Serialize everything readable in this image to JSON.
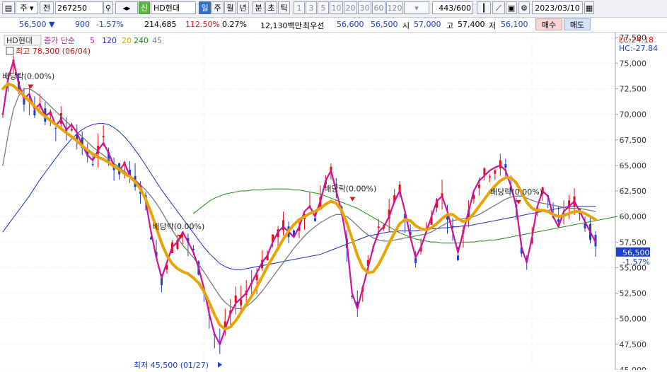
{
  "toolbar": {
    "period": "주",
    "code_prefix": "전",
    "stock_code": "267250",
    "stock_name_badge": "신",
    "stock_name": "HD현대",
    "timeframes": [
      "일",
      "주",
      "월",
      "년",
      "분",
      "초",
      "틱"
    ],
    "active_timeframe": "일",
    "periods": [
      "1",
      "3",
      "5",
      "10",
      "20",
      "30",
      "60",
      "120"
    ],
    "count": "443",
    "count_total": "/600",
    "date": "2023/03/10"
  },
  "quote": {
    "price": "56,500",
    "change": "900",
    "change_pct": "-1.57%",
    "volume": "214,685",
    "volume_ratio": "112.50%",
    "turnover": "0.27%",
    "amount": "12,130백만",
    "best_ask_label": "최우선",
    "best_ask": "56,600",
    "best_bid": "56,500",
    "open_label": "시",
    "open": "57,000",
    "high_label": "고",
    "high": "57,400",
    "low_label": "저",
    "low": "56,100",
    "buy_label": "매수",
    "sell_label": "매도"
  },
  "legend": {
    "title": "HD현대",
    "label": "종가 단순",
    "periods": [
      "5",
      "120",
      "20",
      "240",
      "45"
    ],
    "colors": [
      "#d0109a",
      "#1a2ecc",
      "#e2a400",
      "#1b8a1b",
      "#808080"
    ],
    "high_info": "최고 78,300 (06/04)"
  },
  "right_labels": {
    "lc": "LC:24.18",
    "hc": "HC:-27.84",
    "current_price": "56,500",
    "current_pct": "-1.57%"
  },
  "colors": {
    "up": "#e01010",
    "down": "#1a3fd0",
    "ma5": "#d0109a",
    "ma20": "#e8a400",
    "ma45": "#7a7a7a",
    "ma120": "#1a2ecc",
    "ma240": "#1b8a1b"
  },
  "chart_data": {
    "type": "line",
    "title": "HD현대",
    "ylim": [
      45000,
      78000
    ],
    "y_ticks": [
      "77,500",
      "75,000",
      "72,500",
      "70,000",
      "67,500",
      "65,000",
      "62,500",
      "60,000",
      "57,500",
      "55,000",
      "52,500",
      "50,000",
      "47,500",
      "45,000"
    ],
    "y_tick_values": [
      77500,
      75000,
      72500,
      70000,
      67500,
      65000,
      62500,
      60000,
      57500,
      55000,
      52500,
      50000,
      47500,
      45000
    ],
    "series": [
      {
        "name": "5",
        "values": [
          70000,
          73500,
          75200,
          73000,
          71500,
          72000,
          70500,
          71000,
          69800,
          70200,
          68900,
          69500,
          68500,
          69000,
          68200,
          67000,
          66000,
          65500,
          66500,
          67200,
          66200,
          65000,
          64500,
          65200,
          64000,
          63500,
          63000,
          61500,
          58500,
          56000,
          54000,
          55500,
          57000,
          57500,
          58500,
          57500,
          56500,
          55000,
          53000,
          50500,
          48500,
          47500,
          49000,
          50500,
          51500,
          52000,
          52500,
          53500,
          54500,
          55500,
          56200,
          57500,
          58500,
          59000,
          58500,
          58000,
          59000,
          60500,
          61000,
          60000,
          61500,
          63500,
          64500,
          62500,
          60500,
          57500,
          52500,
          51000,
          53000,
          55000,
          57000,
          58500,
          59000,
          60000,
          61500,
          62500,
          60500,
          58000,
          56000,
          57000,
          58500,
          60000,
          61500,
          62000,
          60500,
          58500,
          56500,
          58500,
          60500,
          62500,
          63500,
          64000,
          64500,
          64800,
          65000,
          64500,
          63000,
          61000,
          57000,
          55500,
          58000,
          61000,
          62500,
          62000,
          60000,
          59000,
          60500,
          61000,
          61500,
          60500,
          59500,
          58500,
          57500
        ]
      },
      {
        "name": "20",
        "values": [
          72500,
          73000,
          72800,
          72300,
          71800,
          71300,
          70800,
          70200,
          69800,
          69400,
          69000,
          68600,
          68200,
          67800,
          67400,
          66900,
          66500,
          66100,
          65800,
          65600,
          65300,
          64900,
          64600,
          64200,
          63900,
          63400,
          62700,
          61700,
          60400,
          58900,
          57400,
          56200,
          55400,
          54900,
          54600,
          54400,
          54000,
          53500,
          52700,
          51600,
          50400,
          49400,
          49000,
          49200,
          49800,
          50600,
          51400,
          52200,
          53100,
          54100,
          55100,
          56000,
          56900,
          57800,
          58600,
          59200,
          59700,
          60000,
          60300,
          60500,
          60800,
          61200,
          61500,
          61300,
          60600,
          59400,
          57800,
          56200,
          55000,
          54500,
          54600,
          55300,
          56300,
          57400,
          58400,
          59300,
          59700,
          59600,
          59100,
          58800,
          58700,
          58900,
          59300,
          59800,
          60200,
          60200,
          59800,
          59500,
          59700,
          60300,
          61000,
          61700,
          62400,
          63000,
          63500,
          63800,
          63800,
          63300,
          62400,
          61400,
          60800,
          60600,
          60600,
          60500,
          60200,
          60000,
          60100,
          60300,
          60500,
          60500,
          60300,
          60000,
          59700
        ]
      },
      {
        "name": "45",
        "values": [
          65000,
          68000,
          70500,
          71800,
          72500,
          72500,
          72200,
          71800,
          71300,
          70800,
          70300,
          69800,
          69300,
          68800,
          68300,
          67800,
          67300,
          66800,
          66400,
          66000,
          65600,
          65200,
          64800,
          64400,
          64000,
          63600,
          63100,
          62600,
          62000,
          61300,
          60500,
          59600,
          58700,
          57900,
          57200,
          56600,
          56000,
          55300,
          54600,
          53800,
          53000,
          52200,
          51600,
          51200,
          51000,
          51000,
          51200,
          51600,
          52100,
          52700,
          53400,
          54100,
          54800,
          55500,
          56200,
          56900,
          57500,
          58100,
          58600,
          59000,
          59400,
          59700,
          60000,
          60200,
          60200,
          60000,
          59600,
          59100,
          58600,
          58200,
          57900,
          57700,
          57600,
          57600,
          57700,
          57800,
          57900,
          58000,
          58100,
          58200,
          58300,
          58500,
          58800,
          59100,
          59400,
          59600,
          59700,
          59800,
          59900,
          60000,
          60200,
          60500,
          60800,
          61100,
          61400,
          61700,
          61900,
          62000,
          62000,
          61800,
          61600,
          61400,
          61300,
          61200,
          61100,
          61000,
          60900,
          60800,
          60800,
          60800,
          60700,
          60600,
          60500
        ]
      },
      {
        "name": "120",
        "values": [
          58500,
          59200,
          59900,
          60600,
          61300,
          62000,
          62800,
          63600,
          64300,
          65000,
          65700,
          66400,
          67000,
          67600,
          68100,
          68500,
          68800,
          69000,
          69100,
          69100,
          69000,
          68700,
          68300,
          67800,
          67200,
          66500,
          65800,
          65000,
          64200,
          63400,
          62600,
          61900,
          61200,
          60500,
          59800,
          59100,
          58400,
          57700,
          57000,
          56400,
          55900,
          55400,
          55100,
          54900,
          54800,
          54800,
          54900,
          55000,
          55100,
          55200,
          55300,
          55400,
          55500,
          55600,
          55700,
          55800,
          55900,
          56000,
          56100,
          56200,
          56300,
          56500,
          56700,
          56900,
          57100,
          57300,
          57500,
          57700,
          57900,
          58100,
          58200,
          58300,
          58400,
          58500,
          58500,
          58600,
          58600,
          58600,
          58600,
          58700,
          58700,
          58800,
          58800,
          58900,
          58900,
          59000,
          59000,
          59100,
          59100,
          59200,
          59300,
          59400,
          59500,
          59600,
          59700,
          59800,
          59900,
          60000,
          60100,
          60200,
          60300,
          60400,
          60500,
          60600,
          60700,
          60800,
          60900,
          61000,
          61000,
          61000,
          61000,
          61000,
          61000
        ]
      },
      {
        "name": "240",
        "values": [
          null,
          null,
          null,
          null,
          null,
          null,
          null,
          null,
          null,
          null,
          null,
          null,
          null,
          null,
          null,
          null,
          null,
          null,
          null,
          null,
          null,
          null,
          null,
          null,
          null,
          null,
          null,
          null,
          null,
          null,
          null,
          null,
          null,
          null,
          null,
          null,
          60300,
          60700,
          61100,
          61500,
          61800,
          62000,
          62200,
          62300,
          62400,
          62500,
          62500,
          62600,
          62600,
          62600,
          62700,
          62700,
          62700,
          62700,
          62700,
          62600,
          62600,
          62500,
          62400,
          62300,
          62200,
          62000,
          61800,
          61600,
          61400,
          61200,
          61000,
          60800,
          60500,
          60200,
          59900,
          59600,
          59300,
          59000,
          58700,
          58400,
          58200,
          58000,
          57800,
          57700,
          57600,
          57500,
          57500,
          57400,
          57400,
          57400,
          57400,
          57500,
          57500,
          57500,
          57600,
          57600,
          57700,
          57700,
          57800,
          57900,
          58000,
          58100,
          58200,
          58300,
          58400,
          58500,
          58600,
          58700,
          58800,
          58900,
          59000,
          59100,
          59200,
          59300,
          59400,
          59500,
          59600,
          59700,
          59800,
          59900,
          60000
        ]
      }
    ],
    "annotations": [
      {
        "text": "배당락(0.00%)",
        "x": 0.047,
        "y": 72500
      },
      {
        "text": "배당락(0.00%)",
        "x": 0.3,
        "y": 57800
      },
      {
        "text": "배당락(0.00%)",
        "x": 0.59,
        "y": 61500
      },
      {
        "text": "배당락(0.00%)",
        "x": 0.87,
        "y": 61200
      },
      {
        "text": "최저 45,500 (01/27)",
        "x": 0.37,
        "y": 45500
      }
    ]
  }
}
